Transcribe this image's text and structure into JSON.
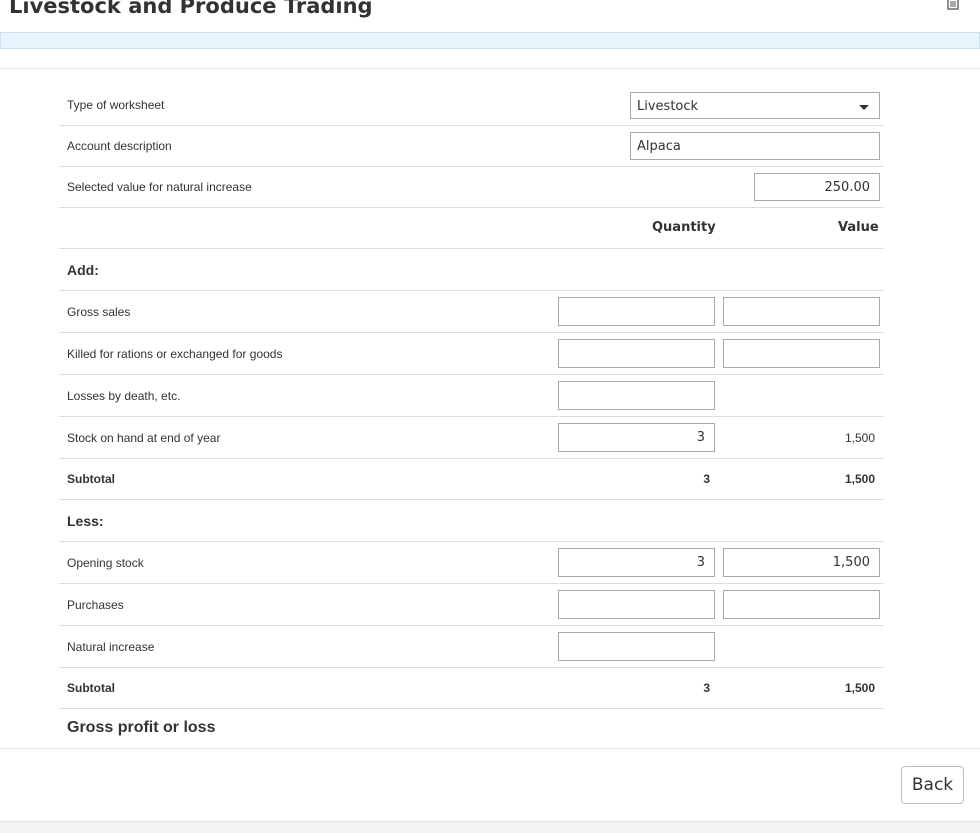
{
  "header": {
    "title": "Livestock and Produce Trading",
    "delete_icon": "trash-icon"
  },
  "form": {
    "worksheet_type_label": "Type of worksheet",
    "worksheet_type_value": "Livestock",
    "account_description_label": "Account description",
    "account_description_value": "Alpaca",
    "natural_increase_value_label": "Selected value for natural increase",
    "natural_increase_value": "250.00"
  },
  "columns": {
    "quantity": "Quantity",
    "value": "Value"
  },
  "add": {
    "heading": "Add:",
    "rows": [
      {
        "label": "Gross sales",
        "quantity": "",
        "value": ""
      },
      {
        "label": "Killed for rations or exchanged for goods",
        "quantity": "",
        "value": ""
      },
      {
        "label": "Losses by death, etc.",
        "quantity": ""
      },
      {
        "label": "Stock on hand at end of year",
        "quantity": "3",
        "value": "1,500"
      }
    ],
    "subtotal": {
      "label": "Subtotal",
      "quantity": "3",
      "value": "1,500"
    }
  },
  "less": {
    "heading": "Less:",
    "rows": [
      {
        "label": "Opening stock",
        "quantity": "3",
        "value": "1,500"
      },
      {
        "label": "Purchases",
        "quantity": "",
        "value": ""
      },
      {
        "label": "Natural increase",
        "quantity": ""
      }
    ],
    "subtotal": {
      "label": "Subtotal",
      "quantity": "3",
      "value": "1,500"
    }
  },
  "gross_profit_label": "Gross profit or loss",
  "footer": {
    "back_label": "Back"
  }
}
